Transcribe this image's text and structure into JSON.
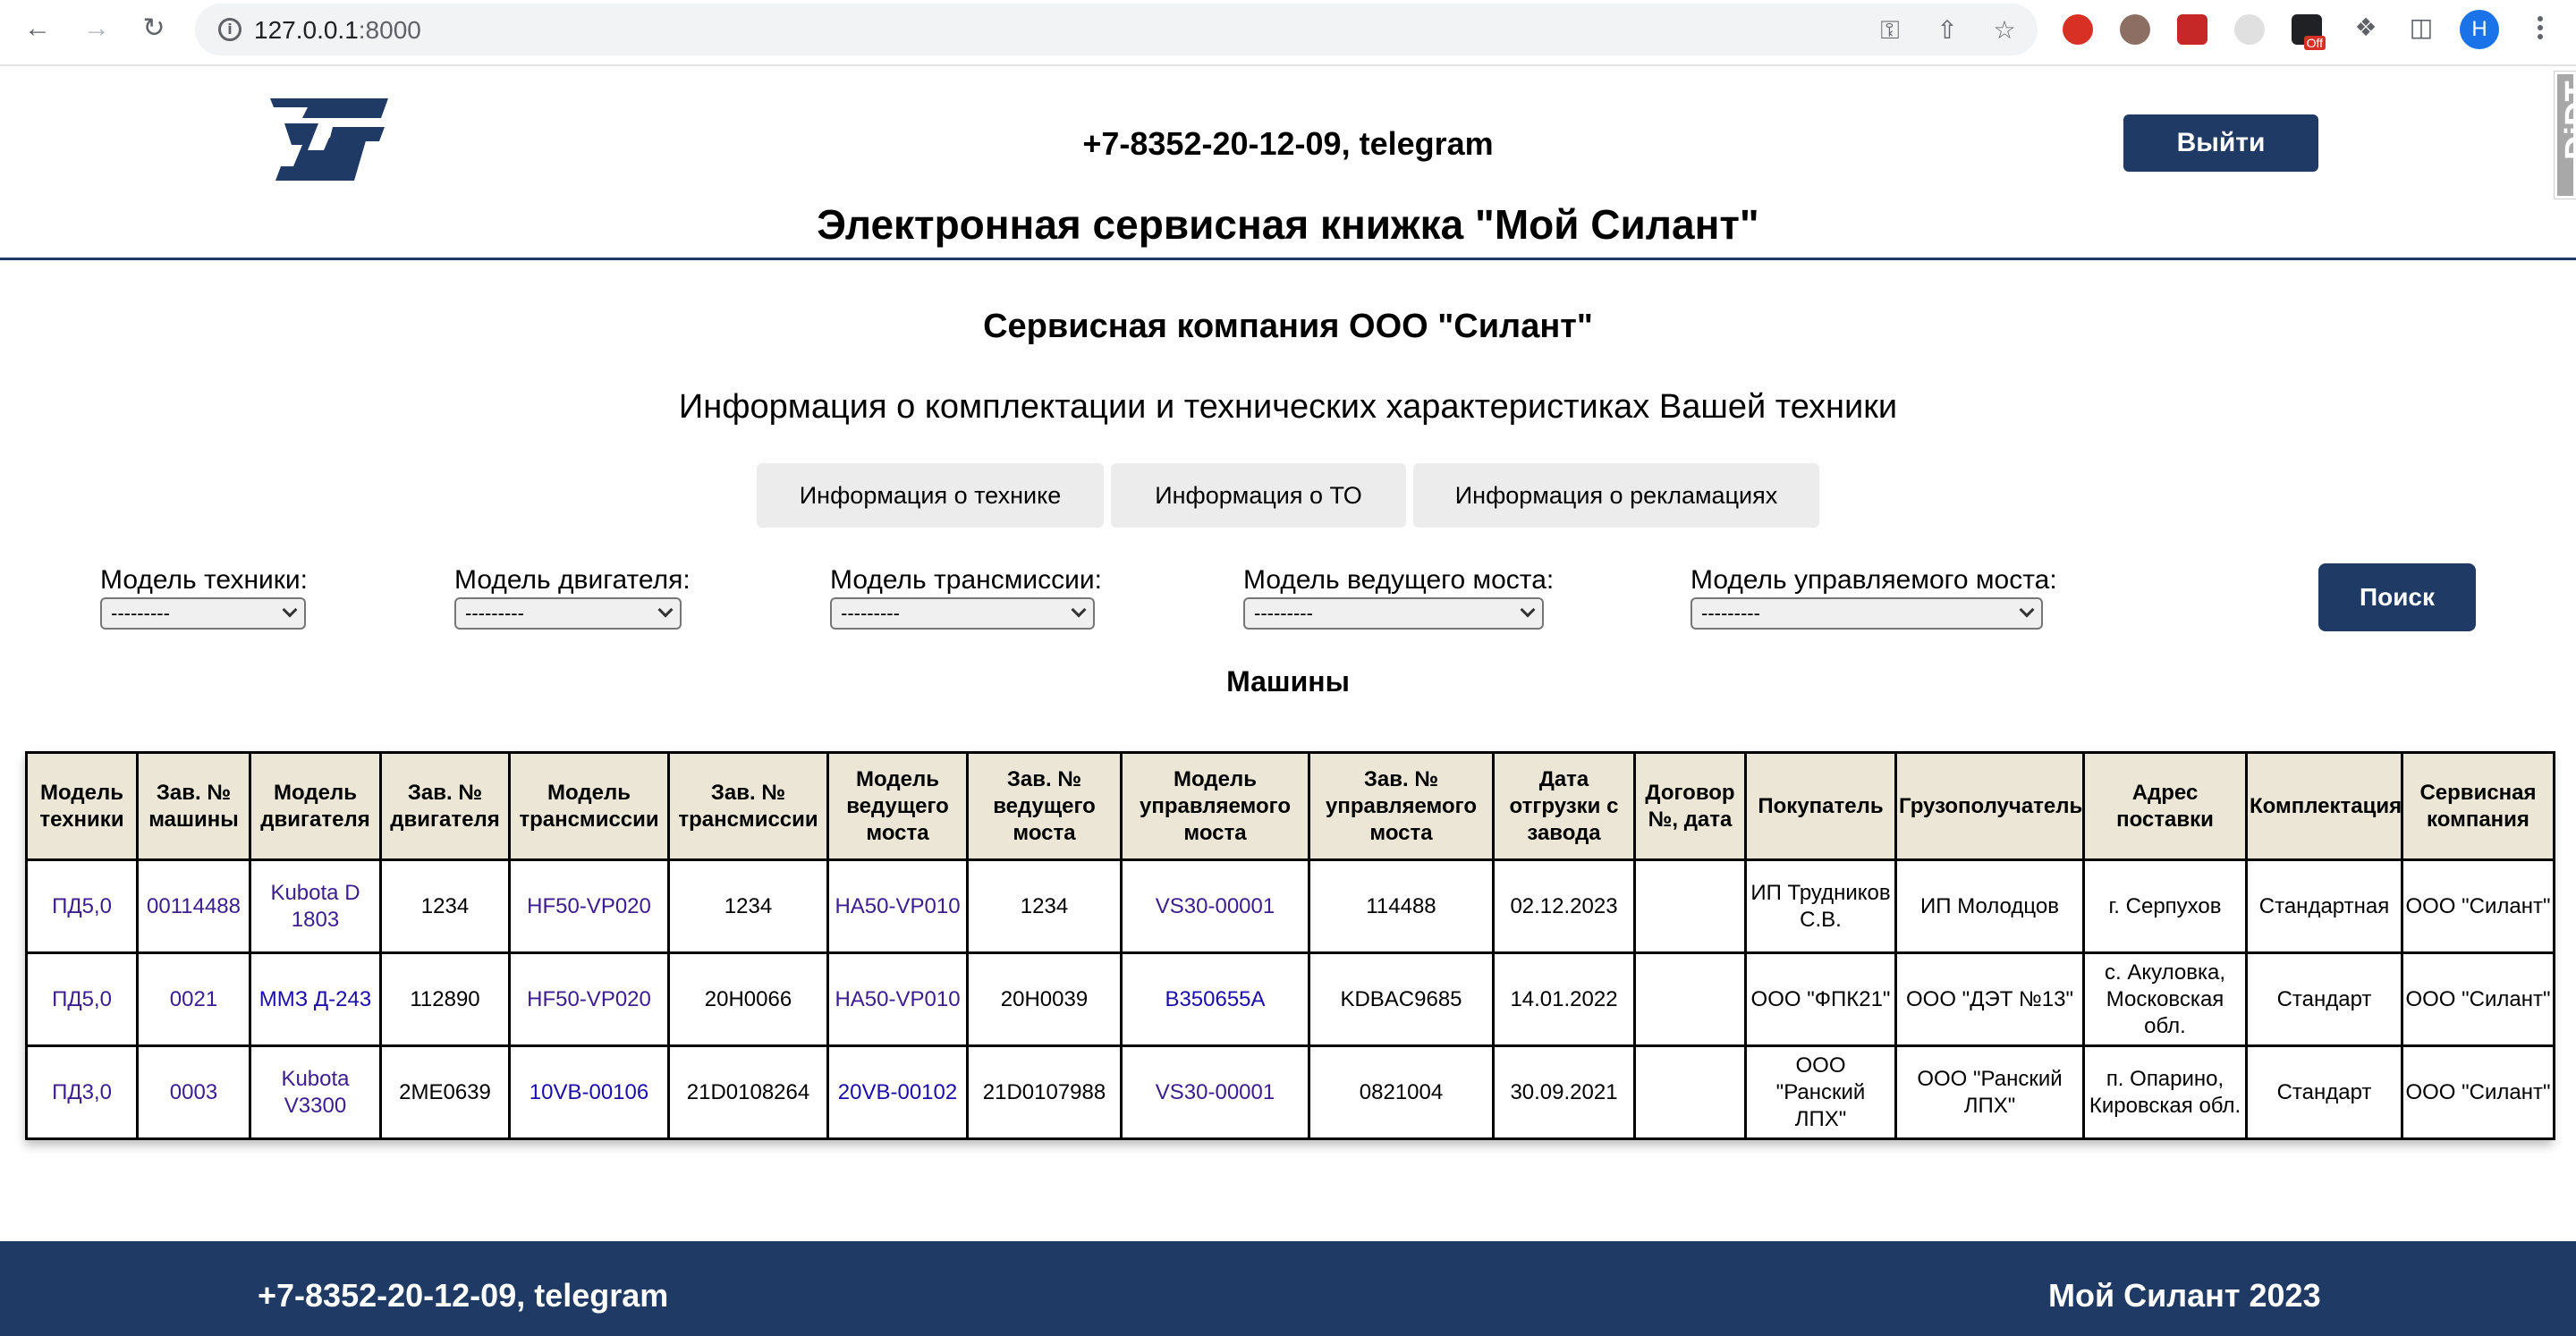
{
  "browser": {
    "url_host": "127.0.0.1",
    "url_port": ":8000",
    "profile_initial": "H",
    "ext_badge": "Off"
  },
  "header": {
    "phone": "+7-8352-20-12-09, telegram",
    "logout_label": "Выйти",
    "title": "Электронная сервисная книжка \"Мой Силант\"",
    "debug_toolbar": "DjDT"
  },
  "company": "Сервисная компания ООО \"Силант\"",
  "subtitle": "Информация о комплектации и технических характеристиках Вашей техники",
  "tabs": [
    {
      "label": "Информация о технике"
    },
    {
      "label": "Информация о ТО"
    },
    {
      "label": "Информация о рекламациях"
    }
  ],
  "filters": [
    {
      "label": "Модель техники:",
      "value": "---------"
    },
    {
      "label": "Модель двигателя:",
      "value": "---------"
    },
    {
      "label": "Модель трансмиссии:",
      "value": "---------"
    },
    {
      "label": "Модель ведущего моста:",
      "value": "---------"
    },
    {
      "label": "Модель управляемого моста:",
      "value": "---------"
    }
  ],
  "search_label": "Поиск",
  "table_title": "Машины",
  "table": {
    "columns": [
      "Модель техники",
      "Зав. № машины",
      "Модель двигателя",
      "Зав. № двигателя",
      "Модель трансмиссии",
      "Зав. № трансмиссии",
      "Модель ведущего моста",
      "Зав. № ведущего моста",
      "Модель управляемого моста",
      "Зав. № управляемого моста",
      "Дата отгрузки с завода",
      "Договор №, дата",
      "Покупатель",
      "Грузополучатель",
      "Адрес поставки",
      "Комплектация",
      "Сервисная компания"
    ],
    "rows": [
      [
        "ПД5,0",
        "00114488",
        "Kubota D 1803",
        "1234",
        "HF50-VP020",
        "1234",
        "HA50-VP010",
        "1234",
        "VS30-00001",
        "114488",
        "02.12.2023",
        "",
        "ИП Трудников С.В.",
        "ИП Молодцов",
        "г. Серпухов",
        "Стандартная",
        "ООО \"Силант\""
      ],
      [
        "ПД5,0",
        "0021",
        "ММЗ Д-243",
        "112890",
        "HF50-VP020",
        "20H0066",
        "HA50-VP010",
        "20H0039",
        "B350655A",
        "KDBAC9685",
        "14.01.2022",
        "",
        "ООО \"ФПК21\"",
        "ООО \"ДЭТ №13\"",
        "с. Акуловка, Московская обл.",
        "Стандарт",
        "ООО \"Силант\""
      ],
      [
        "ПД3,0",
        "0003",
        "Kubota V3300",
        "2ME0639",
        "10VB-00106",
        "21D0108264",
        "20VB-00102",
        "21D0107988",
        "VS30-00001",
        "0821004",
        "30.09.2021",
        "",
        "ООО \"Ранский ЛПХ\"",
        "ООО \"Ранский ЛПХ\"",
        "п. Опарино, Кировская обл.",
        "Стандарт",
        "ООО \"Силант\""
      ]
    ]
  },
  "footer": {
    "phone": "+7-8352-20-12-09, telegram",
    "brand": "Мой Силант 2023"
  },
  "colors": {
    "brand_navy": "#1f3a64",
    "header_cell_bg": "#ece6d6",
    "link_purple": "#3b1d8f",
    "link_blue": "#1a0dab"
  }
}
